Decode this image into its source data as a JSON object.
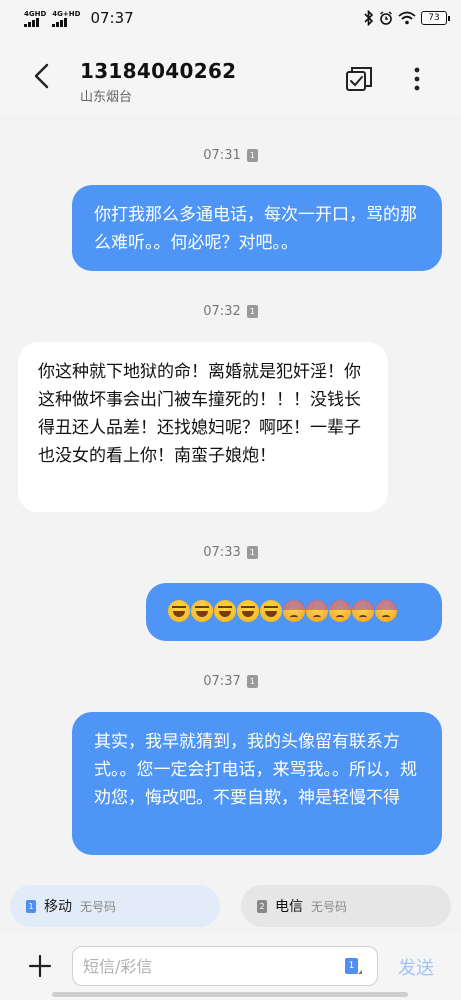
{
  "status_bar": {
    "network1": "4GHD",
    "network2": "4G+HD",
    "time": "07:37",
    "battery": "73",
    "icons": [
      "bluetooth-icon",
      "alarm-icon",
      "wifi-icon",
      "battery-icon"
    ]
  },
  "header": {
    "contact_number": "13184040262",
    "contact_location": "山东烟台",
    "icons": [
      "back-arrow-icon",
      "select-icon",
      "more-icon"
    ]
  },
  "messages": [
    {
      "timestamp": "07:31",
      "sim": "1",
      "direction": "out",
      "text": "你打我那么多通电话，每次一开口，骂的那么难听。。何必呢？对吧。。"
    },
    {
      "timestamp": "07:32",
      "sim": "1",
      "direction": "in",
      "text": "你这种就下地狱的命！离婚就是犯奸淫！你这种做坏事会出门被车撞死的！！！没钱长得丑还人品差！还找媳妇呢？啊呸！一辈子也没女的看上你！南蛮子娘炮！"
    },
    {
      "timestamp": "07:33",
      "sim": "1",
      "direction": "out",
      "emojis": [
        "tears-of-joy",
        "tears-of-joy",
        "tears-of-joy",
        "tears-of-joy",
        "tears-of-joy",
        "weary",
        "weary",
        "weary",
        "weary",
        "weary"
      ]
    },
    {
      "timestamp": "07:37",
      "sim": "1",
      "direction": "out",
      "text": "其实，我早就猜到，我的头像留有联系方式。。您一定会打电话，来骂我。。所以，规劝您，悔改吧。不要自欺，神是轻慢不得"
    }
  ],
  "sim_selector": {
    "sim1": {
      "badge": "1",
      "carrier": "移动",
      "status": "无号码",
      "selected": true
    },
    "sim2": {
      "badge": "2",
      "carrier": "电信",
      "status": "无号码",
      "selected": false
    }
  },
  "composer": {
    "placeholder": "短信/彩信",
    "sim_badge": "1",
    "send_label": "发送"
  },
  "colors": {
    "outgoing_bubble": "#4e95f5",
    "incoming_bubble": "#ffffff",
    "send_disabled": "#9ec3f5"
  }
}
